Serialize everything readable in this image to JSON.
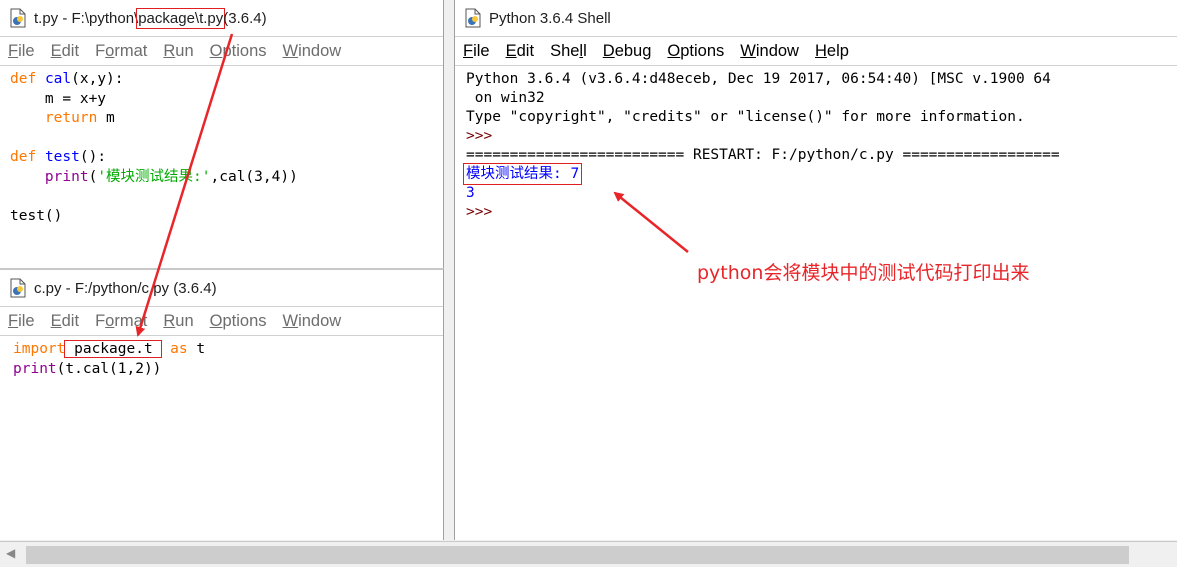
{
  "editor_t": {
    "title_prefix": "t.py - F:\\python\\",
    "title_highlight": "package\\t.py",
    "title_suffix": " (3.6.4)",
    "menu": [
      "File",
      "Edit",
      "Format",
      "Run",
      "Options",
      "Window"
    ],
    "code": {
      "l1_kw": "def",
      "l1_name": "cal",
      "l1_rest": "(x,y):",
      "l2": "    m = x+y",
      "l3_indent": "    ",
      "l3_kw": "return",
      "l3_rest": " m",
      "l5_kw": "def",
      "l5_name": "test",
      "l5_rest": "():",
      "l6_indent": "    ",
      "l6_bi": "print",
      "l6_open": "(",
      "l6_str": "'模块测试结果:'",
      "l6_rest": ",cal(3,4))",
      "l8": "test()"
    }
  },
  "editor_c": {
    "title": "c.py - F:/python/c.py (3.6.4)",
    "menu": [
      "File",
      "Edit",
      "Format",
      "Run",
      "Options",
      "Window"
    ],
    "code": {
      "l1_kw": "import",
      "l1_hl": " package.t ",
      "l1_kw2": "as",
      "l1_rest": " t",
      "l2_bi": "print",
      "l2_rest": "(t.cal(1,2))"
    }
  },
  "shell": {
    "title": "Python 3.6.4 Shell",
    "menu": [
      "File",
      "Edit",
      "Shell",
      "Debug",
      "Options",
      "Window",
      "Help"
    ],
    "lines": {
      "banner1": "Python 3.6.4 (v3.6.4:d48eceb, Dec 19 2017, 06:54:40) [MSC v.1900 64",
      "banner2": " on win32",
      "banner3": "Type \"copyright\", \"credits\" or \"license()\" for more information.",
      "prompt": ">>>",
      "restart": "========================= RESTART: F:/python/c.py ==================",
      "out1": "模块测试结果: 7",
      "out2": "3",
      "prompt2": ">>>"
    }
  },
  "annotation": "python会将模块中的测试代码打印出来",
  "colors": {
    "highlight_box": "#e02020",
    "arrow": "#e8262a",
    "keyword": "#ff7700",
    "definition": "#0000ff",
    "builtin": "#900090",
    "string": "#00aa00",
    "stdout": "#0000ff"
  }
}
